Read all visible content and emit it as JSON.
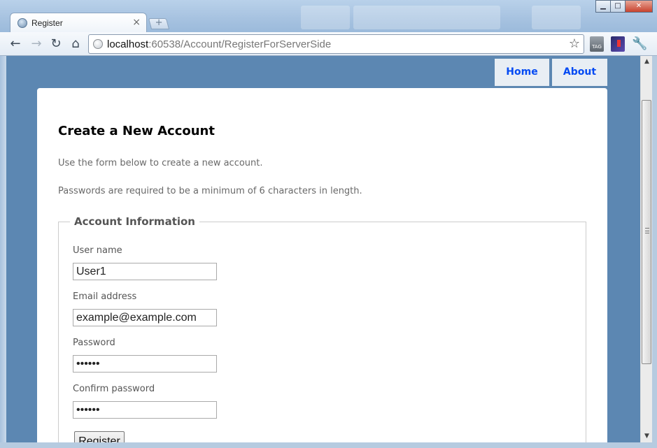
{
  "browser": {
    "tab_title": "Register",
    "tab_close": "×",
    "new_tab": "+",
    "url_host": "localhost",
    "url_path": ":60538/Account/RegisterForServerSide",
    "window_buttons": {
      "minimize": "▁",
      "maximize": "□",
      "close": "✕"
    },
    "nav": {
      "back": "←",
      "forward": "→",
      "reload": "↻",
      "home": "⌂"
    },
    "star": "☆",
    "extensions": {
      "tag": "TAG",
      "wrench": "🔧"
    }
  },
  "menu": {
    "items": [
      {
        "label": "Home"
      },
      {
        "label": "About"
      }
    ]
  },
  "page": {
    "title": "Create a New Account",
    "intro": "Use the form below to create a new account.",
    "password_note": "Passwords are required to be a minimum of 6 characters in length."
  },
  "form": {
    "legend": "Account Information",
    "username_label": "User name",
    "username_value": "User1",
    "email_label": "Email address",
    "email_value": "example@example.com",
    "password_label": "Password",
    "password_value": "••••••",
    "confirm_label": "Confirm password",
    "confirm_value": "••••••",
    "submit_label": "Register"
  },
  "scrollbar": {
    "up": "▲",
    "down": "▼"
  },
  "colors": {
    "page_background": "#5c87b2",
    "menu_link": "#034af3",
    "menu_background": "#e8eef4"
  }
}
